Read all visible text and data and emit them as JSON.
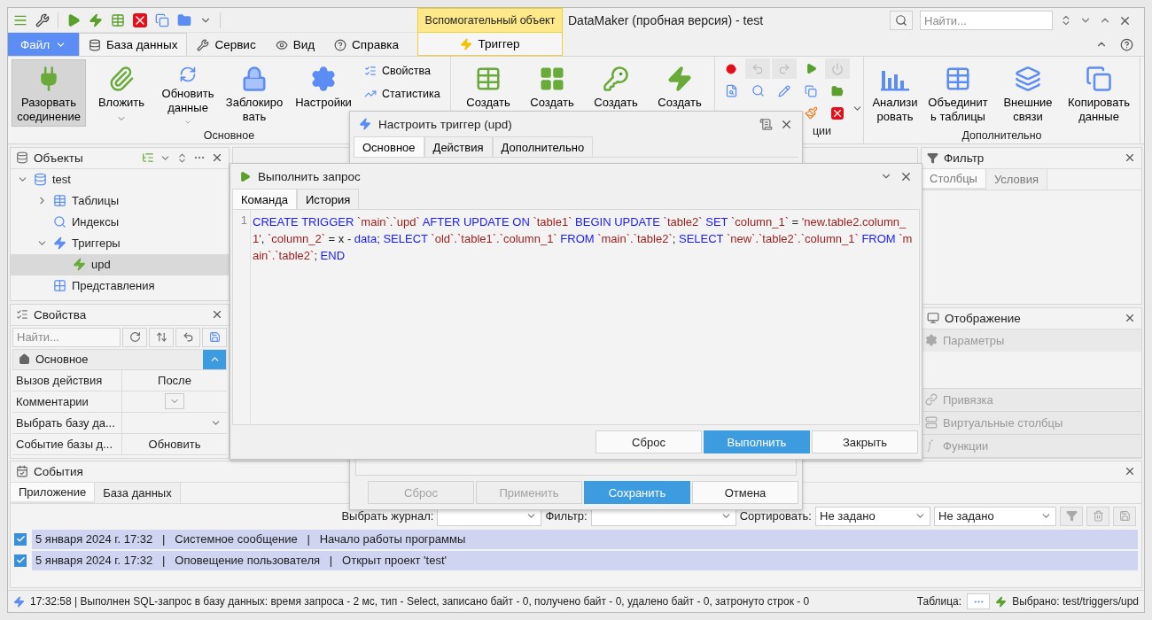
{
  "title_bar": {
    "context_group": "Вспомогательный объект",
    "title": "DataMaker (пробная версия) - test",
    "search_placeholder": "Найти..."
  },
  "menu": {
    "file": "Файл",
    "tabs": [
      {
        "label": "База данных",
        "selected": true
      },
      {
        "label": "Сервис",
        "selected": false
      },
      {
        "label": "Вид",
        "selected": false
      },
      {
        "label": "Справка",
        "selected": false
      }
    ],
    "context_tab": {
      "label": "Триггер",
      "selected": false
    }
  },
  "ribbon": {
    "main": {
      "label": "Основное",
      "buttons": [
        {
          "label": "Разорвать соединение",
          "pressed": true,
          "dropdown": false
        },
        {
          "label": "Вложить",
          "pressed": false,
          "dropdown": true
        },
        {
          "label": "Обновить данные",
          "pressed": false,
          "dropdown": true
        },
        {
          "label": "Заблокировать",
          "pressed": false,
          "dropdown": false
        },
        {
          "label": "Настройки",
          "pressed": false,
          "dropdown": false
        }
      ],
      "small_buttons": [
        "Свойства",
        "Статистика"
      ]
    },
    "create": {
      "buttons": [
        "Создать",
        "Создать",
        "Создать",
        "Создать"
      ]
    },
    "operations": {
      "label": "ции"
    },
    "extra": {
      "label": "Дополнительно",
      "buttons": [
        "Анализировать",
        "Объединить таблицы",
        "Внешние связи",
        "Копировать данные"
      ]
    }
  },
  "objects_panel": {
    "title": "Объекты",
    "tree": [
      {
        "label": "test",
        "kind": "database",
        "selected": false,
        "expanded": true,
        "children": [
          {
            "label": "Таблицы",
            "kind": "tables",
            "selected": false,
            "expanded": false
          },
          {
            "label": "Индексы",
            "kind": "indexes",
            "selected": false
          },
          {
            "label": "Триггеры",
            "kind": "triggers",
            "selected": false,
            "expanded": true,
            "children": [
              {
                "label": "upd",
                "kind": "trigger",
                "selected": true
              }
            ]
          },
          {
            "label": "Представления",
            "kind": "views",
            "selected": false
          }
        ]
      }
    ]
  },
  "properties_panel": {
    "title": "Свойства",
    "search_placeholder": "Найти...",
    "category": {
      "label": "Основное",
      "expanded": true
    },
    "rows": [
      {
        "name": "Вызов действия",
        "kind": "text",
        "value": "После"
      },
      {
        "name": "Комментарии",
        "kind": "button"
      },
      {
        "name": "Выбрать базу да...",
        "kind": "select"
      },
      {
        "name": "Событие базы д...",
        "kind": "text",
        "value": "Обновить"
      }
    ]
  },
  "trigger_dialog": {
    "title": "Настроить триггер (upd)",
    "tabs": [
      {
        "label": "Основное",
        "selected": true
      },
      {
        "label": "Действия",
        "selected": false
      },
      {
        "label": "Дополнительно",
        "selected": false
      }
    ],
    "buttons": [
      {
        "label": "Сброс",
        "disabled": true,
        "primary": false
      },
      {
        "label": "Применить",
        "disabled": true,
        "primary": false
      },
      {
        "label": "Сохранить",
        "disabled": false,
        "primary": true
      },
      {
        "label": "Отмена",
        "disabled": false,
        "primary": false
      }
    ]
  },
  "query_dialog": {
    "title": "Выполнить запрос",
    "tabs": [
      {
        "label": "Команда",
        "selected": true
      },
      {
        "label": "История",
        "selected": false
      }
    ],
    "line_number": "1",
    "code": [
      {
        "text": "CREATE TRIGGER",
        "kind": "keyword"
      },
      {
        "text": " `main`.`upd` ",
        "kind": "name"
      },
      {
        "text": "AFTER UPDATE ON",
        "kind": "keyword"
      },
      {
        "text": " `table1` ",
        "kind": "name"
      },
      {
        "text": "BEGIN UPDATE",
        "kind": "keyword"
      },
      {
        "text": " `table2` ",
        "kind": "name"
      },
      {
        "text": "SET",
        "kind": "keyword"
      },
      {
        "text": " `column_1` ",
        "kind": "name"
      },
      {
        "text": "= ",
        "kind": "plain"
      },
      {
        "text": "'new.table2.column_1'",
        "kind": "name"
      },
      {
        "text": ", ",
        "kind": "plain"
      },
      {
        "text": "`column_2`",
        "kind": "name"
      },
      {
        "text": " = x - ",
        "kind": "plain"
      },
      {
        "text": "data",
        "kind": "keyword"
      },
      {
        "text": "; ",
        "kind": "plain"
      },
      {
        "text": "SELECT",
        "kind": "keyword"
      },
      {
        "text": " `old`.`table1`.`column_1` ",
        "kind": "name"
      },
      {
        "text": "FROM",
        "kind": "keyword"
      },
      {
        "text": " `main`.`table2`",
        "kind": "name"
      },
      {
        "text": "; ",
        "kind": "plain"
      },
      {
        "text": "SELECT",
        "kind": "keyword"
      },
      {
        "text": " `new`.`table2`.`column_1` ",
        "kind": "name"
      },
      {
        "text": "FROM",
        "kind": "keyword"
      },
      {
        "text": " `main`.`table2`",
        "kind": "name"
      },
      {
        "text": "; ",
        "kind": "plain"
      },
      {
        "text": "END",
        "kind": "keyword"
      }
    ],
    "buttons": [
      {
        "label": "Сброс",
        "primary": false
      },
      {
        "label": "Выполнить",
        "primary": true
      },
      {
        "label": "Закрыть",
        "primary": false
      }
    ]
  },
  "filter_panel": {
    "title": "Фильтр",
    "tabs": [
      {
        "label": "Столбцы",
        "selected": true
      },
      {
        "label": "Условия",
        "selected": false
      }
    ]
  },
  "display_panel": {
    "title": "Отображение",
    "sections": [
      {
        "label": "Параметры",
        "disabled": true,
        "open": true
      },
      {
        "label": "Привязка",
        "disabled": true,
        "open": false
      },
      {
        "label": "Виртуальные столбцы",
        "disabled": true,
        "open": false
      },
      {
        "label": "Функции",
        "disabled": true,
        "open": false
      }
    ]
  },
  "events_panel": {
    "title": "События",
    "tabs": [
      {
        "label": "Приложение",
        "selected": true
      },
      {
        "label": "База данных",
        "selected": false
      }
    ],
    "journal_label": "Выбрать журнал:",
    "filter_label": "Фильтр:",
    "sort_label": "Сортировать:",
    "sort_values": [
      "Не задано",
      "Не задано"
    ],
    "entries": [
      {
        "checked": true,
        "text": "5 января 2024 г. 17:32   |   Системное сообщение   |   Начало работы программы"
      },
      {
        "checked": true,
        "text": "5 января 2024 г. 17:32   |   Оповещение пользователя   |   Открыт проект 'test'"
      }
    ]
  },
  "status_bar": {
    "message": "17:32:58 | Выполнен SQL-запрос в базу данных: время запроса - 2 мс, тип - Select, записано байт - 0, получено байт - 0, удалено байт - 0, затронуто строк - 0",
    "table_label": "Таблица:",
    "selection": "Выбрано: test/triggers/upd"
  }
}
